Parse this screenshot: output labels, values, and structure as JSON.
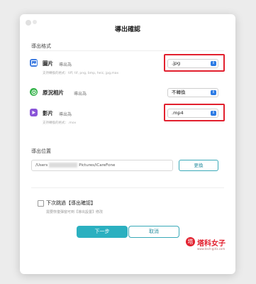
{
  "dialog": {
    "title": "導出確認"
  },
  "format_section": {
    "label": "導出格式",
    "items": [
      {
        "name": "圖片",
        "export_as": "導出為",
        "selected": ".jpg",
        "supported": "支持轉換的格式：tiff, tif, png, bmp, heic, jpg,max",
        "icon": "image-icon",
        "icon_color": "#3d7be0"
      },
      {
        "name": "原況相片",
        "export_as": "導出為",
        "selected": "不轉換",
        "supported": "",
        "icon": "live-photo-icon",
        "icon_color": "#35b34a"
      },
      {
        "name": "影片",
        "export_as": "導出為",
        "selected": ".mp4",
        "supported": "支持轉換的格式：.mov",
        "icon": "video-icon",
        "icon_color": "#8a55d8"
      }
    ]
  },
  "location_section": {
    "label": "導出位置",
    "path_prefix": "/Users",
    "path_suffix": "Pictures/iCareFone",
    "change_label": "更換"
  },
  "skip": {
    "label": "下次跳過【導出確認】",
    "hint": "需要恢復彈窗可到【導出設置】修改"
  },
  "buttons": {
    "next_label": "下一步",
    "cancel_label": "取消"
  },
  "watermark": {
    "text": "塔科女子",
    "url": "www.tech-girlz.com"
  },
  "colors": {
    "accent": "#2bb0c0",
    "highlight": "#e2202e",
    "select_arrow": "#2c7be5"
  }
}
